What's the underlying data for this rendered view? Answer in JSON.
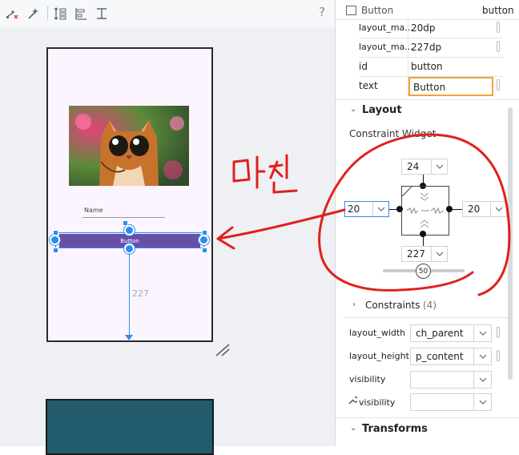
{
  "toolbar": {
    "help_label": "?",
    "icons": [
      "clear-constraints-icon",
      "infer-constraints-icon",
      "align-vertical-icon",
      "align-left-icon",
      "guideline-icon"
    ]
  },
  "canvas": {
    "name_field_text": "Name",
    "button_text": "Button",
    "bottom_margin_label": "227"
  },
  "panel": {
    "widget_type": "Button",
    "widget_id_short": "button",
    "attributes": [
      {
        "name": "layout_ma...",
        "value": "20dp"
      },
      {
        "name": "layout_ma...",
        "value": "227dp"
      },
      {
        "name": "id",
        "value": "button"
      },
      {
        "name": "text",
        "value": "Button"
      }
    ],
    "layout_title": "Layout",
    "constraint_widget_label": "Constraint Widget",
    "margins": {
      "top": "24",
      "left": "20",
      "right": "20",
      "bottom": "227"
    },
    "bias_value": "50",
    "constraints_label": "Constraints",
    "constraints_count": "(4)",
    "layout_width_label": "layout_width",
    "layout_width_value": "ch_parent",
    "layout_height_label": "layout_height",
    "layout_height_value": "p_content",
    "visibility_label": "visibility",
    "visibility2_label": "visibility",
    "transforms_title": "Transforms"
  },
  "annotation": {
    "text": "마진",
    "color": "#e0201c"
  },
  "colors": {
    "accent": "#2d8cf0",
    "button": "#6a4fa8",
    "phone_bg": "#fcf5ff",
    "highlight": "#f2a33a"
  }
}
